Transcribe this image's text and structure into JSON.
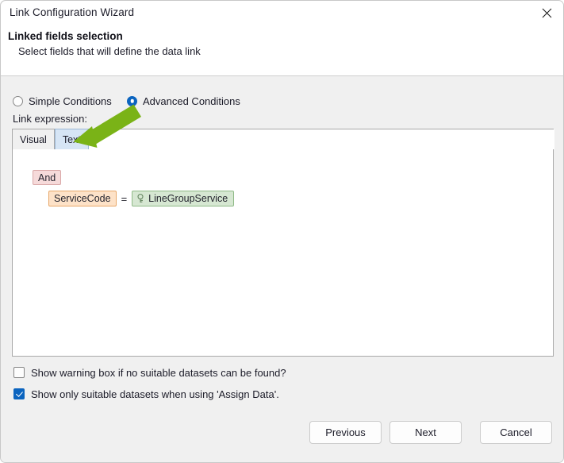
{
  "window": {
    "title": "Link Configuration Wizard",
    "close_icon": "close-icon"
  },
  "header": {
    "heading": "Linked fields selection",
    "subtitle": "Select fields that will define the data link"
  },
  "conditions": {
    "mode_options": [
      {
        "label": "Simple Conditions",
        "selected": false
      },
      {
        "label": "Advanced Conditions",
        "selected": true
      }
    ],
    "simple_label": "Simple Conditions",
    "advanced_label": "Advanced Conditions"
  },
  "expression": {
    "section_label": "Link expression:",
    "tabs": [
      {
        "label": "Visual",
        "state": "active"
      },
      {
        "label": "Text",
        "state": "hover"
      }
    ],
    "visual_tab_label": "Visual",
    "text_tab_label": "Text",
    "tree": {
      "operator_node": "And",
      "condition": {
        "field": "ServiceCode",
        "operator": "=",
        "value": "LineGroupService",
        "value_icon": "key-icon"
      }
    }
  },
  "options": [
    {
      "label": "Show warning box if no suitable datasets can be found?",
      "checked": false
    },
    {
      "label": "Show only suitable datasets when using 'Assign Data'.",
      "checked": true
    }
  ],
  "footer": {
    "previous_label": "Previous",
    "next_label": "Next",
    "cancel_label": "Cancel"
  },
  "annotation": {
    "type": "arrow",
    "color": "#7ab317",
    "points_to": "Text tab"
  },
  "colors": {
    "accent": "#0b64bf",
    "window_bg": "#f0f0f0",
    "panel_bg": "#ffffff",
    "chip_and_bg": "#f6dada",
    "chip_field_bg": "#fde2c8",
    "chip_value_bg": "#d6e7d2",
    "annotation_green": "#7ab317"
  }
}
